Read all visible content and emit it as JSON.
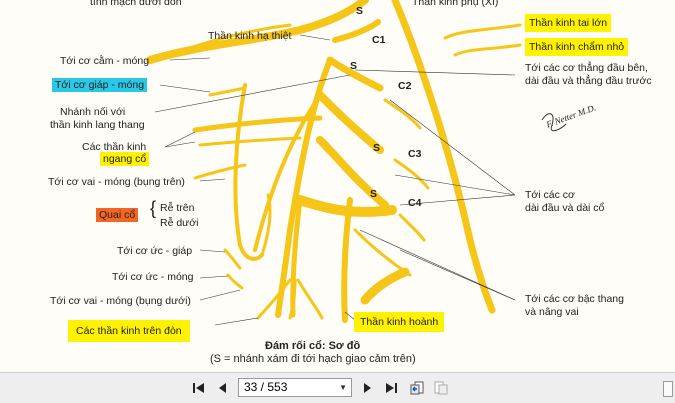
{
  "colors": {
    "nerve": "#f5c518",
    "highlight_yellow": "#fff200",
    "highlight_cyan": "#29c8e6",
    "highlight_orange": "#f26522"
  },
  "labels": {
    "top_cut": "tĩnh mạch dưới đòn",
    "top_right_cut": "Thần kinh phụ (XI)",
    "hypoglossal": "Thần kinh hạ thiệt",
    "S": "S",
    "C1": "C1",
    "C2": "C2",
    "C3": "C3",
    "C4": "C4",
    "geniohyoid": "Tới cơ cằm - móng",
    "thyrohyoid": "Tới cơ giáp - móng",
    "vagus_branch_1": "Nhánh nối với",
    "vagus_branch_2": "thần kinh lang thang",
    "transverse_1": "Các thần kinh",
    "transverse_2": "ngang cổ",
    "omohyoid_upper": "Tới cơ vai - móng (bụng trên)",
    "ansa": "Quai cổ",
    "root_upper": "Rễ trên",
    "root_lower": "Rễ dưới",
    "sternothyroid": "Tới cơ ức - giáp",
    "sternohyoid": "Tới cơ ức - móng",
    "omohyoid_lower": "Tới cơ vai - móng (bụng dưới)",
    "supraclavicular": "Các thần kinh trên đòn",
    "phrenic": "Thần kinh hoành",
    "lesser_occipital": "Thần kinh chẩm nhỏ",
    "great_auricular": "Thần kinh tai lớn",
    "rectus_1": "Tới các cơ thẳng đầu bên,",
    "rectus_2": "dài đầu và thẳng đầu trước",
    "longus_1": "Tới các cơ",
    "longus_2": "dài đầu và dài cổ",
    "scalene_1": "Tới các cơ bậc thang",
    "scalene_2": "và nâng vai",
    "caption_title": "Đám rối cổ: Sơ đồ",
    "caption_sub": "(S = nhánh xám đi tới hạch giao cảm trên)",
    "signature": "F. Netter M.D."
  },
  "toolbar": {
    "first_icon": "first-page-icon",
    "prev_icon": "previous-page-icon",
    "page_value": "33 / 553",
    "next_icon": "next-page-icon",
    "last_icon": "last-page-icon",
    "back_icon": "go-back-icon",
    "forward_icon": "go-forward-icon"
  }
}
